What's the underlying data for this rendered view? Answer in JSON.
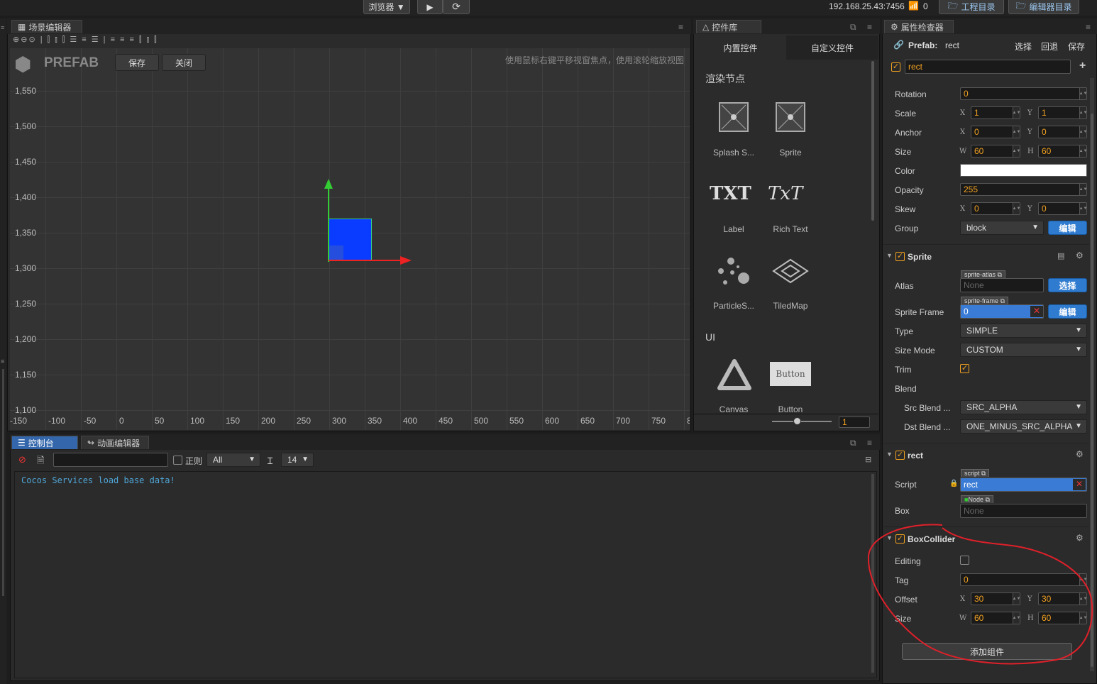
{
  "topbar": {
    "browser_label": "浏览器 ▼",
    "play_icon": "play-icon",
    "refresh_icon": "refresh-icon",
    "ip_address": "192.168.25.43:7456",
    "wifi_count": "0",
    "project_dir": "工程目录",
    "editor_dir": "编辑器目录"
  },
  "scene_editor": {
    "tab_label": "场景编辑器",
    "prefab_label": "PREFAB",
    "save_button": "保存",
    "close_button": "关闭",
    "hint": "使用鼠标右键平移视窗焦点，使用滚轮缩放视图",
    "y_labels": [
      "1,550",
      "1,500",
      "1,450",
      "1,400",
      "1,350",
      "1,300",
      "1,250",
      "1,200",
      "1,150",
      "1,100"
    ],
    "x_labels": [
      "-150",
      "-100",
      "-50",
      "0",
      "50",
      "100",
      "150",
      "200",
      "250",
      "300",
      "350",
      "400",
      "450",
      "500",
      "550",
      "600",
      "650",
      "700",
      "750",
      "8"
    ]
  },
  "widget_library": {
    "tab_label": "控件库",
    "builtin_tab": "内置控件",
    "custom_tab": "自定义控件",
    "section_render": "渲染节点",
    "section_ui": "UI",
    "items": [
      {
        "label": "Splash S..."
      },
      {
        "label": "Sprite"
      },
      {
        "label": "Label",
        "glyph": "TXT"
      },
      {
        "label": "Rich Text",
        "glyph": "TxT"
      },
      {
        "label": "ParticleS..."
      },
      {
        "label": "TiledMap"
      },
      {
        "label": "Canvas"
      },
      {
        "label": "Button",
        "glyph": "Button"
      }
    ],
    "zoom_value": "1"
  },
  "console": {
    "tab_label": "控制台",
    "anim_tab_label": "动画编辑器",
    "regex_label": "正则",
    "filter_value": "All",
    "font_size": "14",
    "log_line": "Cocos Services load base data!"
  },
  "inspector": {
    "tab_label": "属性检查器",
    "prefab_label": "Prefab:",
    "prefab_name": "rect",
    "select_btn": "选择",
    "revert_btn": "回退",
    "save_btn": "保存",
    "node_name": "rect",
    "node": {
      "rotation_label": "Rotation",
      "rotation": "0",
      "scale_label": "Scale",
      "scale_x": "1",
      "scale_y": "1",
      "anchor_label": "Anchor",
      "anchor_x": "0",
      "anchor_y": "0",
      "size_label": "Size",
      "size_w": "60",
      "size_h": "60",
      "color_label": "Color",
      "opacity_label": "Opacity",
      "opacity": "255",
      "skew_label": "Skew",
      "skew_x": "0",
      "skew_y": "0",
      "group_label": "Group",
      "group": "block",
      "group_edit": "编辑"
    },
    "sprite": {
      "title": "Sprite",
      "atlas_label": "Atlas",
      "atlas_tag": "sprite-atlas",
      "atlas_value": "None",
      "atlas_btn": "选择",
      "frame_label": "Sprite Frame",
      "frame_tag": "sprite-frame",
      "frame_value": "0",
      "frame_btn": "编辑",
      "type_label": "Type",
      "type": "SIMPLE",
      "sizemode_label": "Size Mode",
      "sizemode": "CUSTOM",
      "trim_label": "Trim",
      "blend_label": "Blend",
      "src_label": "Src Blend ...",
      "src": "SRC_ALPHA",
      "dst_label": "Dst Blend ...",
      "dst": "ONE_MINUS_SRC_ALPHA"
    },
    "rect_comp": {
      "title": "rect",
      "script_label": "Script",
      "script_tag": "script",
      "script_value": "rect",
      "box_label": "Box",
      "box_tag": "Node",
      "box_value": "None"
    },
    "boxcollider": {
      "title": "BoxCollider",
      "editing_label": "Editing",
      "tag_label": "Tag",
      "tag": "0",
      "offset_label": "Offset",
      "offset_x": "30",
      "offset_y": "30",
      "size_label": "Size",
      "size_w": "60",
      "size_h": "60"
    },
    "add_component": "添加组件",
    "axis": {
      "x": "X",
      "y": "Y",
      "w": "W",
      "h": "H"
    }
  },
  "colors": {
    "accent": "#3366aa",
    "orange": "#f0a020",
    "annotation": "#e0202a",
    "node_fill": "#0a3cff"
  }
}
